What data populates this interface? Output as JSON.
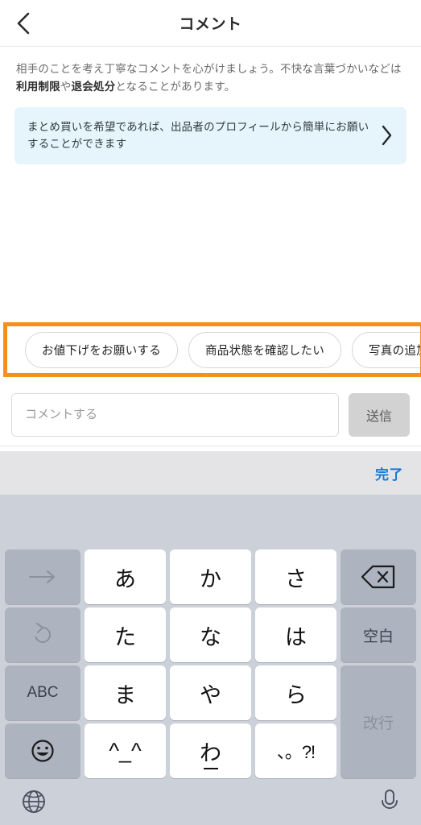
{
  "header": {
    "title": "コメント",
    "back_icon": "chevron-left-icon"
  },
  "notice": {
    "line1_a": "相手のことを考え丁寧なコメントを心がけましょう。不快な言葉づか",
    "line2_a": "いなどは",
    "bold1": "利用制限",
    "line2_b": "や",
    "bold2": "退会処分",
    "line2_c": "となることがあります。"
  },
  "banner": {
    "text": "まとめ買いを希望であれば、出品者のプロフィールから簡単にお願いすることができます",
    "chevron_icon": "chevron-right-icon",
    "background_color": "#e6f5fb"
  },
  "chips": {
    "highlight_color": "#f5901e",
    "items": [
      {
        "label": "お値下げをお願いする"
      },
      {
        "label": "商品状態を確認したい"
      },
      {
        "label": "写真の追加をお願いしたい"
      }
    ]
  },
  "input_bar": {
    "placeholder": "コメントする",
    "value": "",
    "send_label": "送信",
    "send_color": "#d2d2d2"
  },
  "keyboard_toolbar": {
    "done_label": "完了",
    "done_color": "#1779d6"
  },
  "keyboard": {
    "background_color": "#ccd0d9",
    "rows": [
      [
        {
          "name": "arrow-right-key",
          "label": "→",
          "type": "icon-grey"
        },
        {
          "name": "key-a",
          "label": "あ",
          "type": "white"
        },
        {
          "name": "key-ka",
          "label": "か",
          "type": "white"
        },
        {
          "name": "key-sa",
          "label": "さ",
          "type": "white"
        },
        {
          "name": "backspace-key",
          "label": "",
          "type": "icon-grey"
        }
      ],
      [
        {
          "name": "undo-key",
          "label": "↺",
          "type": "icon-grey"
        },
        {
          "name": "key-ta",
          "label": "た",
          "type": "white"
        },
        {
          "name": "key-na",
          "label": "な",
          "type": "white"
        },
        {
          "name": "key-ha",
          "label": "は",
          "type": "white"
        },
        {
          "name": "space-key",
          "label": "空白",
          "type": "grey"
        }
      ],
      [
        {
          "name": "abc-key",
          "label": "ABC",
          "type": "grey"
        },
        {
          "name": "key-ma",
          "label": "ま",
          "type": "white"
        },
        {
          "name": "key-ya",
          "label": "や",
          "type": "white"
        },
        {
          "name": "key-ra",
          "label": "ら",
          "type": "white"
        },
        {
          "name": "return-key",
          "label": "改行",
          "type": "grey-span2"
        }
      ],
      [
        {
          "name": "emoji-key",
          "label": "",
          "type": "icon-grey"
        },
        {
          "name": "key-kaomoji",
          "label": "^_^",
          "type": "white"
        },
        {
          "name": "key-wa",
          "label": "わ",
          "type": "white"
        },
        {
          "name": "key-punctuation",
          "label": "、。?!",
          "type": "white"
        }
      ]
    ],
    "bottom_row": {
      "globe_icon": "globe-icon",
      "mic_icon": "microphone-icon"
    }
  }
}
